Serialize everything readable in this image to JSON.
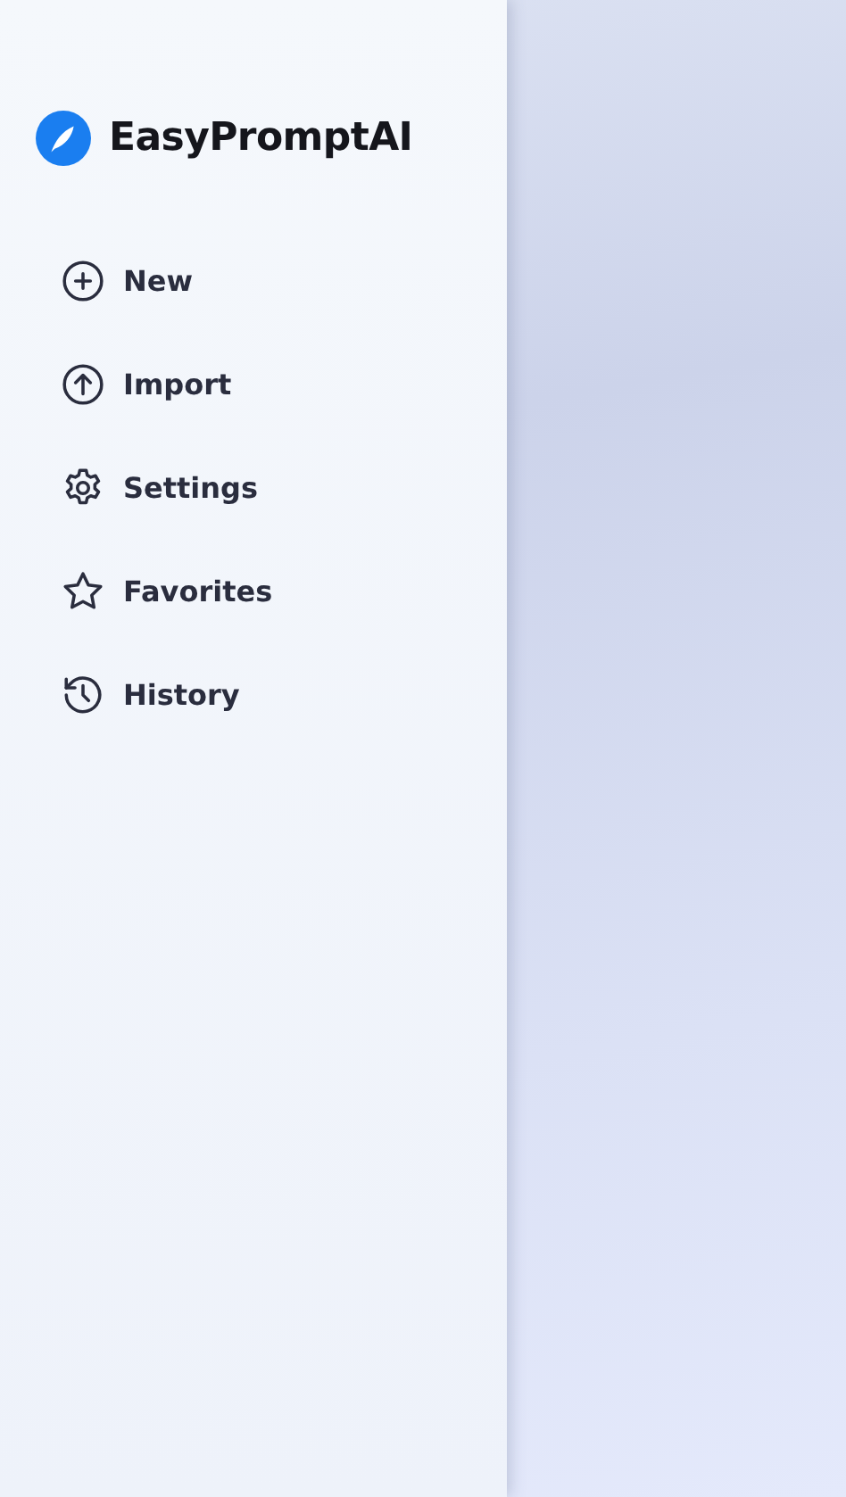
{
  "sidebar": {
    "title": "EasyPromptAI",
    "items": [
      {
        "kind": "new",
        "label": "New"
      },
      {
        "kind": "import",
        "label": "Import"
      },
      {
        "kind": "settings",
        "label": "Settings"
      },
      {
        "kind": "favorites",
        "label": "Favorites"
      },
      {
        "kind": "history",
        "label": "History"
      }
    ]
  }
}
